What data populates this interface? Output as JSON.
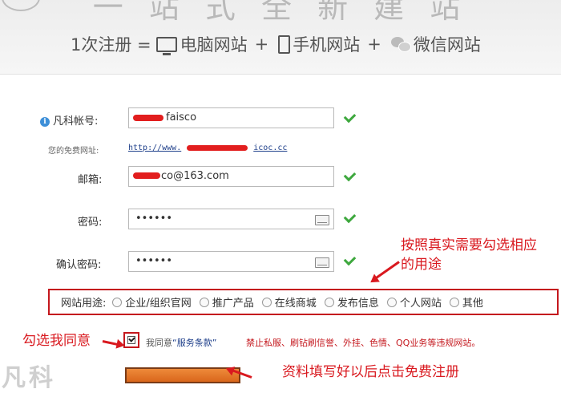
{
  "banner": {
    "partial_text": "一 站 式 全 新 建 站",
    "subtitle": {
      "prefix": "1次注册 =",
      "pc": "电脑网站",
      "plus": "+",
      "mobile": "手机网站",
      "wechat": "微信网站"
    }
  },
  "form": {
    "account": {
      "label": "凡科帐号:",
      "value": "faisco"
    },
    "free_url": {
      "label": "您的免费网址:",
      "value": "http://www.",
      "suffix": "icoc.cc"
    },
    "email": {
      "label": "邮箱:",
      "value": "co@163.com"
    },
    "password": {
      "label": "密码:",
      "value": "••••••"
    },
    "confirm_password": {
      "label": "确认密码:",
      "value": "••••••"
    },
    "purpose": {
      "label": "网站用途:",
      "options": [
        "企业/组织官网",
        "推广产品",
        "在线商城",
        "发布信息",
        "个人网站",
        "其他"
      ]
    },
    "agree": {
      "text_prefix": "我同意",
      "terms_link": "“服务条款”",
      "warning": "禁止私服、刷钻刷信誉、外挂、色情、QQ业务等违规网站。"
    }
  },
  "annotations": {
    "purpose_hint_line1": "按照真实需要勾选相应",
    "purpose_hint_line2": "的用途",
    "agree_hint": "勾选我同意",
    "submit_hint": "资料填写好以后点击免费注册"
  },
  "watermark": "凡科",
  "colors": {
    "annotation_red": "#d9191f",
    "check_green": "#3ea83e",
    "link_blue": "#1e3f8a",
    "button_orange": "#e47b2d"
  }
}
